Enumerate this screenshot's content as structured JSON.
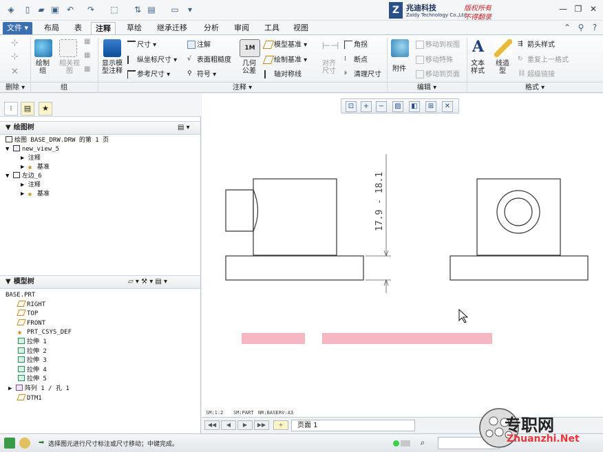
{
  "brand": {
    "logo_mark": "Z",
    "name": "兆迪科技",
    "subtitle": "Zaldy Technology Co.,Ltd.",
    "copyright_line1": "版权所有",
    "copyright_line2": "不得翻录"
  },
  "tabs": [
    "文件",
    "布局",
    "表",
    "注释",
    "草绘",
    "继承迁移",
    "分析",
    "审阅",
    "工具",
    "视图"
  ],
  "ribbon": {
    "delete_group": "删除",
    "group_group": "组",
    "annotate_group": "注释",
    "edit_group": "编辑",
    "format_group": "格式",
    "draw_group": "绘制\n组",
    "related_view": "相关视\n图",
    "show_model_annotations": "显示模\n型注释",
    "dimension": "尺寸",
    "ordinate_dimension": "纵坐标尺寸",
    "reference_dimension": "参考尺寸",
    "note": "注解",
    "surface_finish": "表面粗糙度",
    "symbol": "符号",
    "geometric_tolerance": "几何\n公差",
    "model_datum": "模型基准",
    "draw_datum": "绘制基准",
    "axis_symmetric": "轴对称线",
    "align_dimensions": "对齐\n尺寸",
    "angle": "角拐",
    "break_point": "断点",
    "clean_dimensions": "清理尺寸",
    "attach": "附件",
    "move_to_view": "移动到视图",
    "move_special": "移动特殊",
    "move_to_page": "移动到页面",
    "text_style": "文本\n样式",
    "line_style": "线造\n型",
    "arrow_style": "箭头样式",
    "repeat_last_format": "重复上一格式",
    "hyperlink": "超级链接"
  },
  "drawing_tree": {
    "title": "绘图树",
    "items": [
      {
        "label": "绘图 BASE_DRW.DRW 的第 1 页",
        "level": 0
      },
      {
        "label": "new_view_5",
        "level": 0
      },
      {
        "label": "注释",
        "level": 1
      },
      {
        "label": "基准",
        "level": 1
      },
      {
        "label": "左边_6",
        "level": 0
      },
      {
        "label": "注释",
        "level": 1
      },
      {
        "label": "基准",
        "level": 1
      }
    ]
  },
  "model_tree": {
    "title": "模型树",
    "root": "BASE.PRT",
    "items": [
      "RIGHT",
      "TOP",
      "FRONT",
      "PRT_CSYS_DEF",
      "拉伸 1",
      "拉伸 2",
      "拉伸 3",
      "拉伸 4",
      "拉伸 5",
      "阵列 1 / 孔 1",
      "DTM1"
    ]
  },
  "drawing": {
    "dimension_text": "17.9 - 18.1",
    "scale_text": "SM:1:2",
    "type_text": "SM:PART",
    "name_text": "NR:BASE",
    "size_text": "RV:A3"
  },
  "pagenav": {
    "page_label": "页面 1"
  },
  "status": {
    "message": "选择图元进行尺寸标注或尺寸移动；中键完成。"
  },
  "watermark": {
    "cn": "专职网",
    "url": "Zhuanzhi.Net"
  },
  "colors": {
    "accent": "#3a6fb0",
    "brand_red": "#c0282c",
    "watermark_red": "#e8373d"
  }
}
